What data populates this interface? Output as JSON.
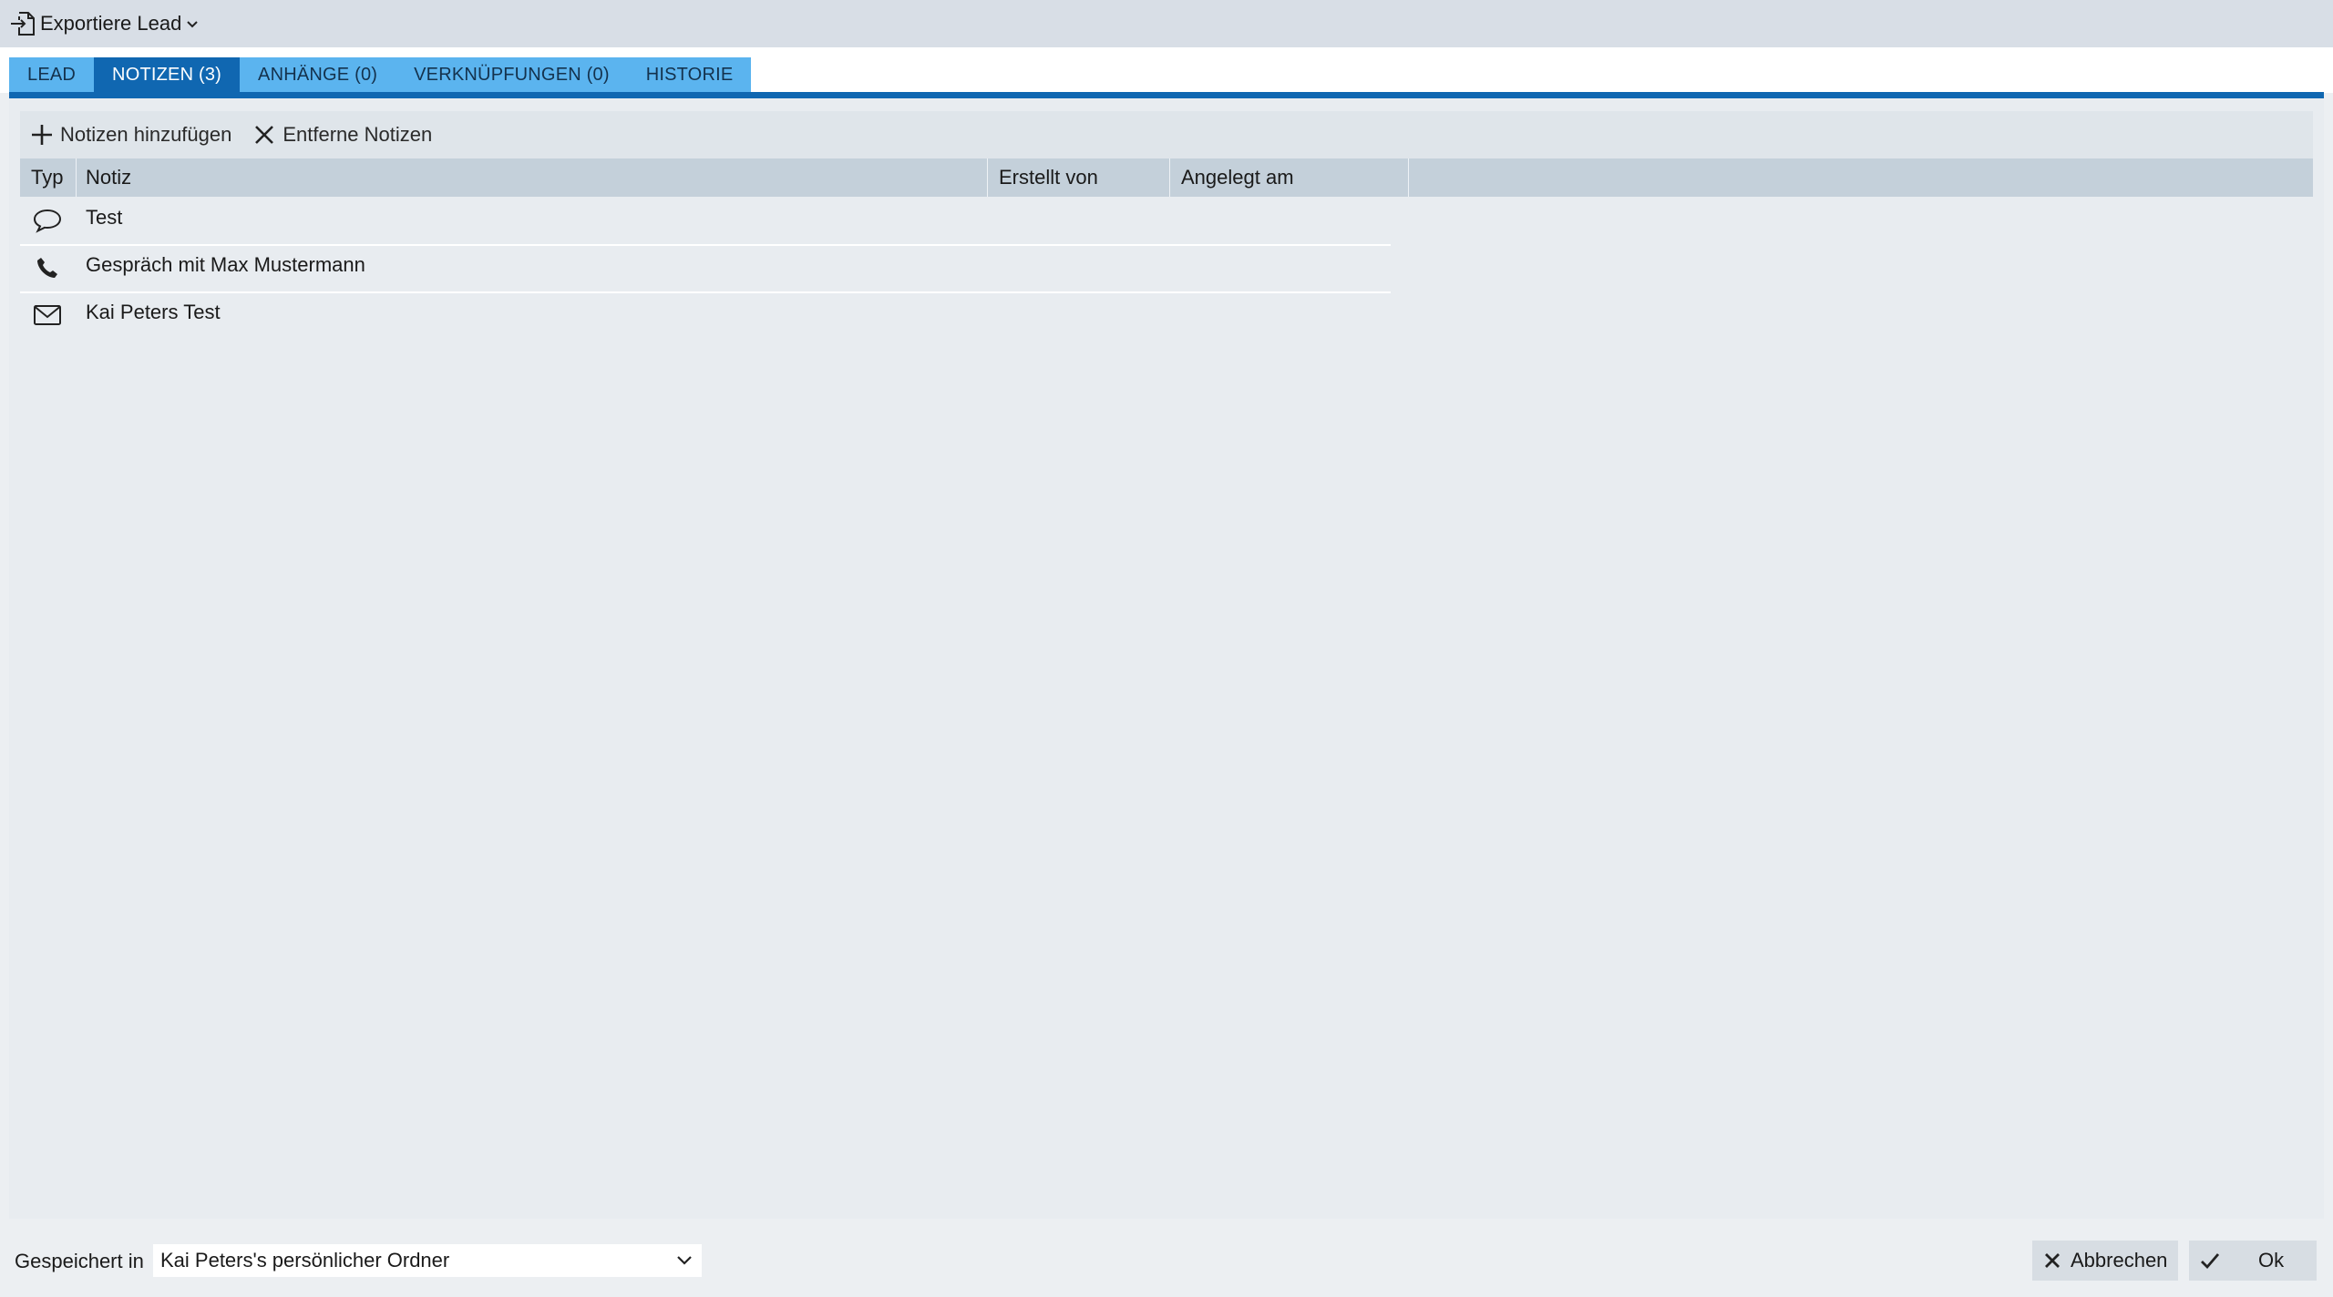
{
  "header": {
    "export_label": "Exportiere Lead"
  },
  "tabs": [
    {
      "label": "LEAD",
      "active": false
    },
    {
      "label": "NOTIZEN (3)",
      "active": true
    },
    {
      "label": "ANHÄNGE (0)",
      "active": false
    },
    {
      "label": "VERKNÜPFUNGEN (0)",
      "active": false
    },
    {
      "label": "HISTORIE",
      "active": false
    }
  ],
  "toolbar": {
    "add_label": "Notizen hinzufügen",
    "remove_label": "Entferne Notizen"
  },
  "grid": {
    "columns": [
      "Typ",
      "Notiz",
      "Erstellt von",
      "Angelegt am"
    ],
    "rows": [
      {
        "type_icon": "speech-bubble-icon",
        "note": "Test",
        "created_by": "",
        "created_at": ""
      },
      {
        "type_icon": "phone-icon",
        "note": "Gespräch mit Max Mustermann",
        "created_by": "",
        "created_at": ""
      },
      {
        "type_icon": "envelope-icon",
        "note": "Kai Peters Test",
        "created_by": "",
        "created_at": ""
      }
    ]
  },
  "footer": {
    "saved_in_label": "Gespeichert in",
    "folder_value": "Kai Peters's persönlicher Ordner",
    "cancel_label": "Abbrechen",
    "ok_label": "Ok"
  },
  "colors": {
    "tab_active": "#1067b1",
    "tab_inactive": "#5bb4ef",
    "grid_header": "#c4d0da",
    "panel_bg": "#e8ecf0"
  }
}
